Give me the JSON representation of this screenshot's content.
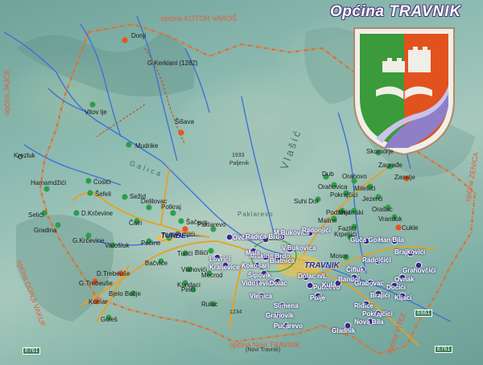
{
  "header": {
    "title_prefix": "Općina",
    "title_name": "TRAVNIK"
  },
  "neighbors": {
    "kotor_varos": "općina KOTOR VAROŠ",
    "jajce": "općina JAJCE",
    "donji_vakuf": "općina DONJI VAKUF",
    "novi_travnik": "općina Novi TRAVNIK",
    "vitez": "općina VITEZ",
    "zenica": "općina ZENICA"
  },
  "mountains": {
    "vlasic": "Vlašić",
    "galica": "Galica",
    "paklarevo": "Paklarevo"
  },
  "roads": {
    "e761_left": "E761",
    "e761_right": "E761",
    "e661": "E661"
  },
  "towns": {
    "travnik": "TRAVNIK",
    "turbe": "TURBE",
    "novi_travnik_sub": "(Novi Travnik)"
  },
  "elevations": {
    "kerkiani": "G.Kerkiani (1282)",
    "p1933": "1933",
    "paljenik": "Paljenik",
    "p1234": "1234"
  },
  "places": [
    {
      "id": "donji",
      "label": "Donji"
    },
    {
      "id": "vitovlje",
      "label": "Vitov lje"
    },
    {
      "id": "sisava",
      "label": "Šišava"
    },
    {
      "id": "mudrike",
      "label": "Mudrike"
    },
    {
      "id": "krezluk",
      "label": "Krezluk"
    },
    {
      "id": "cosici",
      "label": "Ćosići"
    },
    {
      "id": "sefeli",
      "label": "Šefeli"
    },
    {
      "id": "hamamdzici",
      "label": "Hamamdžići"
    },
    {
      "id": "selidi",
      "label": "Selići"
    },
    {
      "id": "dkrcevine",
      "label": "D.Krčevine"
    },
    {
      "id": "gradina",
      "label": "Gradina"
    },
    {
      "id": "gkrcevine",
      "label": "G.Krčevine"
    },
    {
      "id": "sezid",
      "label": "Sežid"
    },
    {
      "id": "delilovac",
      "label": "Delilovac"
    },
    {
      "id": "potkraj",
      "label": "Potkraj"
    },
    {
      "id": "sacevo",
      "label": "Šačevo"
    },
    {
      "id": "runjici",
      "label": "Runjići"
    },
    {
      "id": "varoslak",
      "label": "Varošluk"
    },
    {
      "id": "turbe_p",
      "label": "Turbe"
    },
    {
      "id": "paklarevo_p",
      "label": "Paklarevo"
    },
    {
      "id": "ovcarevo",
      "label": "Ovčarevo"
    },
    {
      "id": "radicabrdo",
      "label": "Radića Brdo"
    },
    {
      "id": "bilici",
      "label": "Bilići"
    },
    {
      "id": "lovrici",
      "label": "Lovrići"
    },
    {
      "id": "kraljevice",
      "label": "Kraljevice"
    },
    {
      "id": "vlahovici",
      "label": "Vlahovići"
    },
    {
      "id": "turici",
      "label": "Turići"
    },
    {
      "id": "bacvice",
      "label": "Bačvice"
    },
    {
      "id": "dtrebeuse",
      "label": "D.Trebeuše"
    },
    {
      "id": "gtrebeuse",
      "label": "G.Trebeuše"
    },
    {
      "id": "komar",
      "label": "Komar"
    },
    {
      "id": "bjelobucje",
      "label": "Bjelo Bučje"
    },
    {
      "id": "kundaci",
      "label": "Kundaci"
    },
    {
      "id": "pirici",
      "label": "Pirići"
    },
    {
      "id": "rulac",
      "label": "Rulac"
    },
    {
      "id": "goles",
      "label": "Goleš"
    },
    {
      "id": "miskinabrdo",
      "label": "Miškina Brdo"
    },
    {
      "id": "kokosari",
      "label": "Kokošari"
    },
    {
      "id": "sipovik",
      "label": "Šipovik"
    },
    {
      "id": "vidosevici",
      "label": "Vidoševići"
    },
    {
      "id": "dolac",
      "label": "Dolac"
    },
    {
      "id": "vlenica",
      "label": "Vlenica"
    },
    {
      "id": "slimena",
      "label": "Slimena"
    },
    {
      "id": "grahovik",
      "label": "Grahovik"
    },
    {
      "id": "pucarevo",
      "label": "Pućarevo"
    },
    {
      "id": "mbukovica",
      "label": "M.Bukovica"
    },
    {
      "id": "vbukovica",
      "label": "V.Bukovica"
    },
    {
      "id": "radonjici",
      "label": "Radonjići"
    },
    {
      "id": "dolaclasva",
      "label": "Dolac n/L"
    },
    {
      "id": "putisevo",
      "label": "Putićevo"
    },
    {
      "id": "polje",
      "label": "Polje"
    },
    {
      "id": "mosor",
      "label": "Mosor"
    },
    {
      "id": "krpeljici",
      "label": "Krpeljići"
    },
    {
      "id": "maline",
      "label": "Maline"
    },
    {
      "id": "podsinje",
      "label": "Podsinje"
    },
    {
      "id": "pokrajcici",
      "label": "Pokrajčici"
    },
    {
      "id": "suhidol",
      "label": "Suhi Dol"
    },
    {
      "id": "dub",
      "label": "Dub"
    },
    {
      "id": "orahovo",
      "label": "Orahovo"
    },
    {
      "id": "skomorje",
      "label": "Skomorje"
    },
    {
      "id": "zagrade",
      "label": "Zagrađe"
    },
    {
      "id": "zaselje",
      "label": "Zaselje"
    },
    {
      "id": "milesici",
      "label": "Milešići"
    },
    {
      "id": "jezerci",
      "label": "Jezerci"
    },
    {
      "id": "orasac",
      "label": "Orašac"
    },
    {
      "id": "vrandul",
      "label": "Vranduk"
    },
    {
      "id": "cukle",
      "label": "Cukle"
    },
    {
      "id": "fazlici",
      "label": "Fazlići"
    },
    {
      "id": "gucagora",
      "label": "Guča Gora"
    },
    {
      "id": "hanbila",
      "label": "Han Bila"
    },
    {
      "id": "brajkovici",
      "label": "Brajkovići"
    },
    {
      "id": "grahovcici",
      "label": "Grahovčići"
    },
    {
      "id": "cifluk",
      "label": "Čifluk"
    },
    {
      "id": "kula",
      "label": "Kula"
    },
    {
      "id": "karaula",
      "label": "Bandol"
    },
    {
      "id": "bandol",
      "label": "Radojčići"
    },
    {
      "id": "grabovac",
      "label": "Grabovac"
    },
    {
      "id": "brajici",
      "label": "Brajići"
    },
    {
      "id": "ridice",
      "label": "Riđice"
    },
    {
      "id": "pokrajcici2",
      "label": "Pokrajčici"
    },
    {
      "id": "gladnik",
      "label": "Gladnik"
    },
    {
      "id": "novabila",
      "label": "Nova Bila"
    },
    {
      "id": "kljaci",
      "label": "Kljaci"
    },
    {
      "id": "ovnak",
      "label": "Ovnak"
    },
    {
      "id": "dolipolje",
      "label": "Docići"
    },
    {
      "id": "mala",
      "label": "Mala"
    },
    {
      "id": "blatnica",
      "label": "Blatnica"
    },
    {
      "id": "mednik",
      "label": "Medinski"
    },
    {
      "id": "mecrod",
      "label": "Mecrod"
    },
    {
      "id": "orahovica",
      "label": "Orahovica"
    },
    {
      "id": "caritas",
      "label": "Čairi"
    },
    {
      "id": "pecine",
      "label": "Pećine"
    }
  ],
  "colors": {
    "green": "#2e9e4a",
    "orange": "#e8541c",
    "purple": "#3a2a8a",
    "river": "#4a7adf",
    "road": "#e8a020",
    "border": "#e07030"
  }
}
